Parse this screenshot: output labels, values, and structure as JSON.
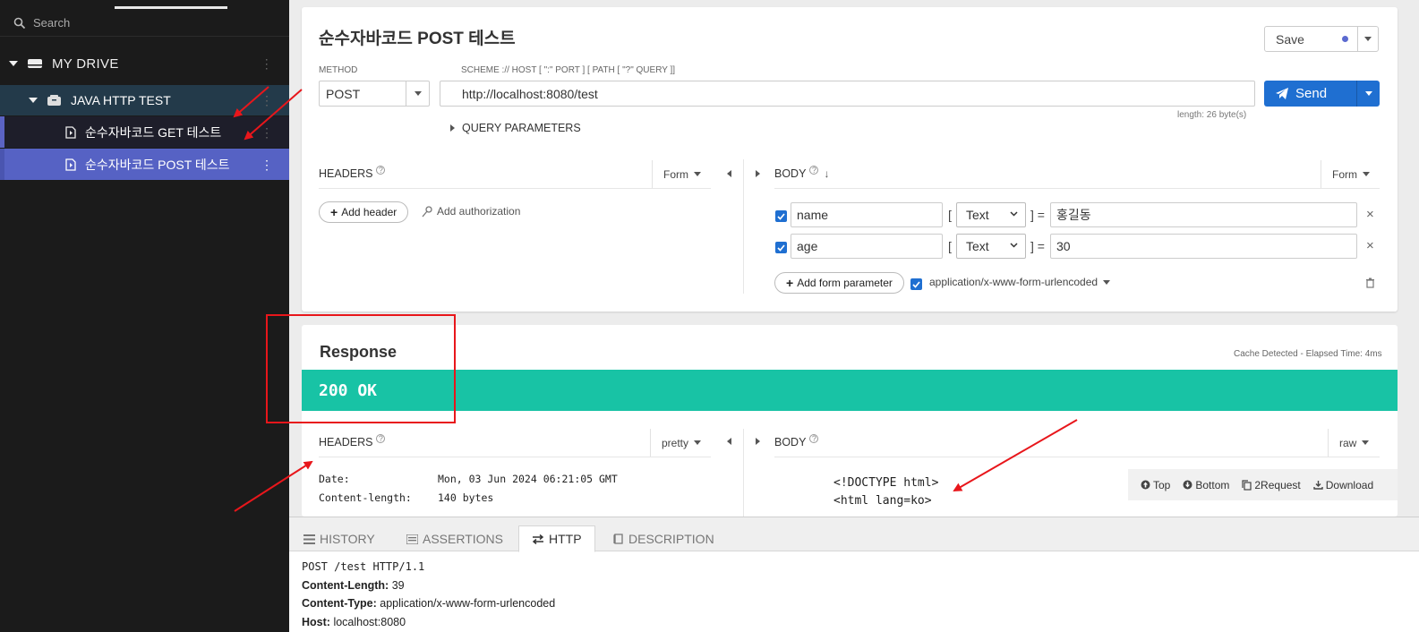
{
  "sidebar": {
    "search_placeholder": "Search",
    "drive_label": "MY DRIVE",
    "project_label": "JAVA HTTP TEST",
    "requests": [
      {
        "label": "순수자바코드 GET 테스트"
      },
      {
        "label": "순수자바코드 POST 테스트"
      }
    ]
  },
  "request": {
    "title": "순수자바코드 POST 테스트",
    "save_label": "Save",
    "method_label": "METHOD",
    "method_value": "POST",
    "scheme_label": "SCHEME :// HOST [ \":\" PORT ] [ PATH [ \"?\" QUERY ]]",
    "url": "http://localhost:8080/test",
    "length_label": "length: 26 byte(s)",
    "send_label": "Send",
    "query_params_label": "QUERY PARAMETERS",
    "headers_label": "HEADERS",
    "headers_mode": "Form",
    "add_header_label": "Add header",
    "add_auth_label": "Add authorization",
    "body_label": "BODY",
    "body_mode": "Form",
    "form_params": [
      {
        "name": "name",
        "type": "Text",
        "value": "홍길동"
      },
      {
        "name": "age",
        "type": "Text",
        "value": "30"
      }
    ],
    "add_form_param_label": "Add form parameter",
    "content_type": "application/x-www-form-urlencoded"
  },
  "response": {
    "title": "Response",
    "cache_label": "Cache Detected - Elapsed Time: 4ms",
    "status": "200 OK",
    "headers_label": "HEADERS",
    "headers_mode": "pretty",
    "headers": [
      {
        "key": "Date:",
        "value": "Mon, 03 Jun 2024 06:21:05 GMT"
      },
      {
        "key": "Content-length:",
        "value": "140 bytes"
      }
    ],
    "body_label": "BODY",
    "body_mode": "raw",
    "body_lines": [
      "<!DOCTYPE html>",
      "<html lang=ko>"
    ],
    "toolbar": {
      "top": "Top",
      "bottom": "Bottom",
      "to_request": "2Request",
      "download": "Download"
    }
  },
  "bottom_tabs": {
    "history": "HISTORY",
    "assertions": "ASSERTIONS",
    "http": "HTTP",
    "description": "DESCRIPTION"
  },
  "http_view": {
    "request_line": "POST /test HTTP/1.1",
    "headers": [
      {
        "key": "Content-Length:",
        "value": "39"
      },
      {
        "key": "Content-Type:",
        "value": "application/x-www-form-urlencoded"
      },
      {
        "key": "Host:",
        "value": "localhost:8080"
      }
    ]
  },
  "colors": {
    "accent": "#1f6fd1",
    "status_ok": "#18c3a5",
    "selected_item": "#5662c4",
    "annotation": "#e8161b"
  }
}
